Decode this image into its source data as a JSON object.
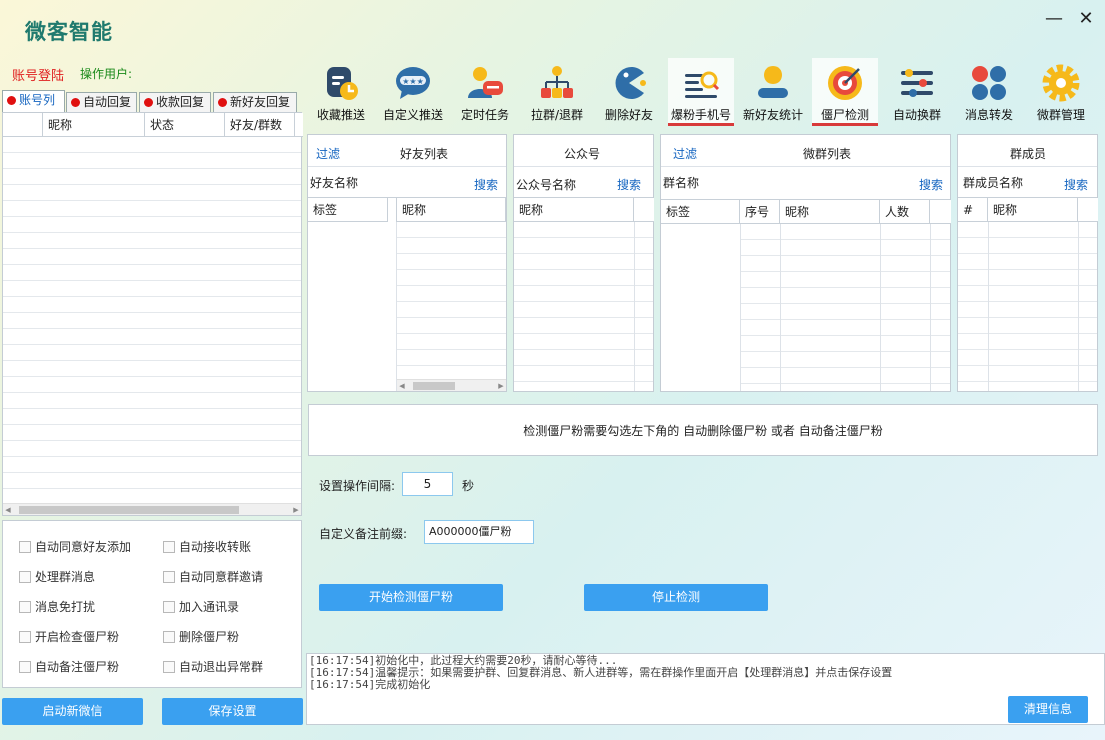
{
  "app": {
    "title": "微客智能"
  },
  "window": {
    "minimize": "—",
    "close": "✕"
  },
  "header": {
    "login": "账号登陆",
    "operator": "操作用户:"
  },
  "toolbar": [
    {
      "label": "收藏推送",
      "icon": "clipboard-clock-icon"
    },
    {
      "label": "自定义推送",
      "icon": "chat-bubble-stars-icon"
    },
    {
      "label": "定时任务",
      "icon": "user-message-icon"
    },
    {
      "label": "拉群/退群",
      "icon": "org-chart-icon"
    },
    {
      "label": "删除好友",
      "icon": "pacman-icon"
    },
    {
      "label": "爆粉手机号",
      "icon": "search-list-icon"
    },
    {
      "label": "新好友统计",
      "icon": "user-stat-icon"
    },
    {
      "label": "僵尸检测",
      "icon": "target-icon"
    },
    {
      "label": "自动换群",
      "icon": "sliders-icon"
    },
    {
      "label": "消息转发",
      "icon": "dots-grid-icon"
    },
    {
      "label": "微群管理",
      "icon": "gear-icon"
    }
  ],
  "left_tabs": [
    "账号列",
    "自动回复",
    "收款回复",
    "新好友回复"
  ],
  "account_table": {
    "columns": [
      "",
      "昵称",
      "状态",
      "好友/群数"
    ]
  },
  "options": [
    "自动同意好友添加",
    "自动接收转账",
    "处理群消息",
    "自动同意群邀请",
    "消息免打扰",
    "加入通讯录",
    "开启检查僵尸粉",
    "删除僵尸粉",
    "自动备注僵尸粉",
    "自动退出异常群"
  ],
  "left_buttons": {
    "start": "启动新微信",
    "save": "保存设置"
  },
  "friends": {
    "filter": "过滤",
    "title": "好友列表",
    "name_label": "好友名称",
    "search": "搜索",
    "columns": [
      "标签",
      "昵称"
    ]
  },
  "official": {
    "title": "公众号",
    "name_label": "公众号名称",
    "search": "搜索",
    "columns": [
      "昵称"
    ]
  },
  "groups": {
    "filter": "过滤",
    "title": "微群列表",
    "name_label": "群名称",
    "search": "搜索",
    "columns": [
      "标签",
      "序号",
      "昵称",
      "人数"
    ]
  },
  "members": {
    "title": "群成员",
    "name_label": "群成员名称",
    "search": "搜索",
    "columns": [
      "#",
      "昵称"
    ]
  },
  "notice": "检测僵尸粉需要勾选左下角的 自动删除僵尸粉 或者 自动备注僵尸粉",
  "interval": {
    "label": "设置操作间隔:",
    "value": "5",
    "unit": "秒"
  },
  "remark": {
    "label": "自定义备注前缀:",
    "value": "A000000僵尸粉"
  },
  "actions": {
    "start": "开始检测僵尸粉",
    "stop": "停止检测"
  },
  "log": [
    "[16:17:54]初始化中，此过程大约需要20秒，请耐心等待...",
    "[16:17:54]温馨提示：如果需要护群、回复群消息、新人进群等，需在群操作里面开启【处理群消息】并点击保存设置",
    "[16:17:54]完成初始化"
  ],
  "clear_button": "清理信息"
}
